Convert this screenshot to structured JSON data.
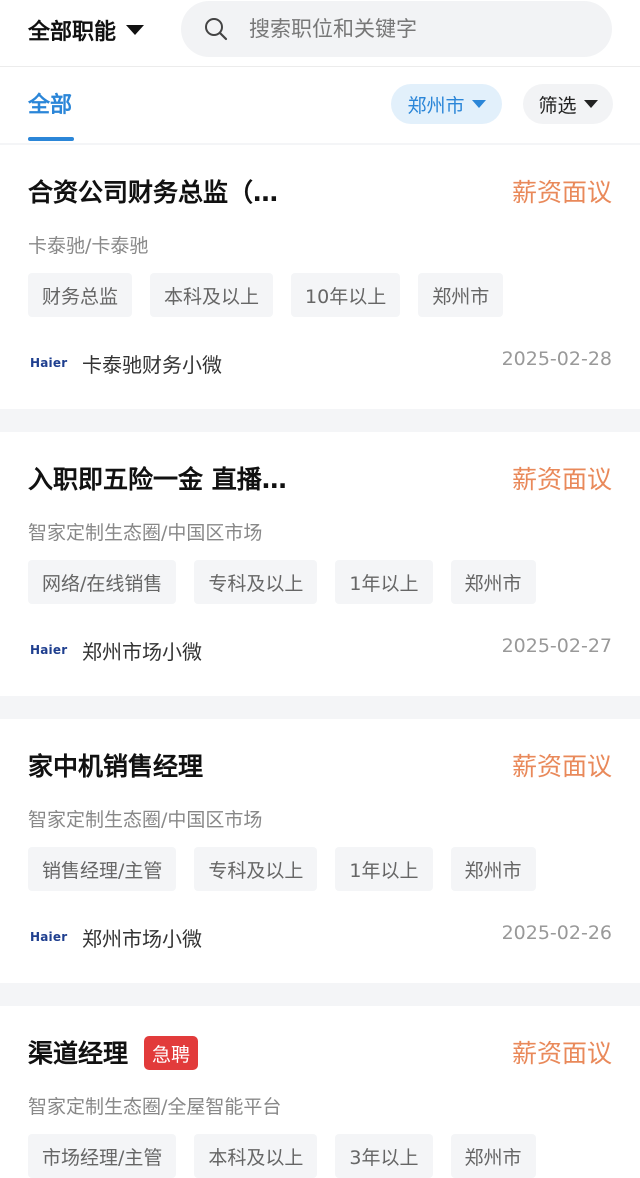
{
  "header": {
    "function_select": "全部职能",
    "search_placeholder": "搜索职位和关键字"
  },
  "filters": {
    "tab_all": "全部",
    "city": "郑州市",
    "filter": "筛选"
  },
  "jobs": [
    {
      "title": "合资公司财务总监（…",
      "badge": "",
      "salary": "薪资面议",
      "company": "卡泰驰/卡泰驰",
      "tags": [
        "财务总监",
        "本科及以上",
        "10年以上",
        "郑州市"
      ],
      "logo": "Haier",
      "recruiter": "卡泰驰财务小微",
      "date": "2025-02-28"
    },
    {
      "title": "入职即五险一金 直播…",
      "badge": "",
      "salary": "薪资面议",
      "company": "智家定制生态圈/中国区市场",
      "tags": [
        "网络/在线销售",
        "专科及以上",
        "1年以上",
        "郑州市"
      ],
      "logo": "Haier",
      "recruiter": "郑州市场小微",
      "date": "2025-02-27"
    },
    {
      "title": "家中机销售经理",
      "badge": "",
      "salary": "薪资面议",
      "company": "智家定制生态圈/中国区市场",
      "tags": [
        "销售经理/主管",
        "专科及以上",
        "1年以上",
        "郑州市"
      ],
      "logo": "Haier",
      "recruiter": "郑州市场小微",
      "date": "2025-02-26"
    },
    {
      "title": "渠道经理",
      "badge": "急聘",
      "salary": "薪资面议",
      "company": "智家定制生态圈/全屋智能平台",
      "tags": [
        "市场经理/主管",
        "本科及以上",
        "3年以上",
        "郑州市"
      ],
      "logo": "",
      "recruiter": "",
      "date": ""
    }
  ],
  "colors": {
    "accent": "#2b86d8",
    "salary": "#e9895a",
    "urgent": "#e23b3b"
  }
}
